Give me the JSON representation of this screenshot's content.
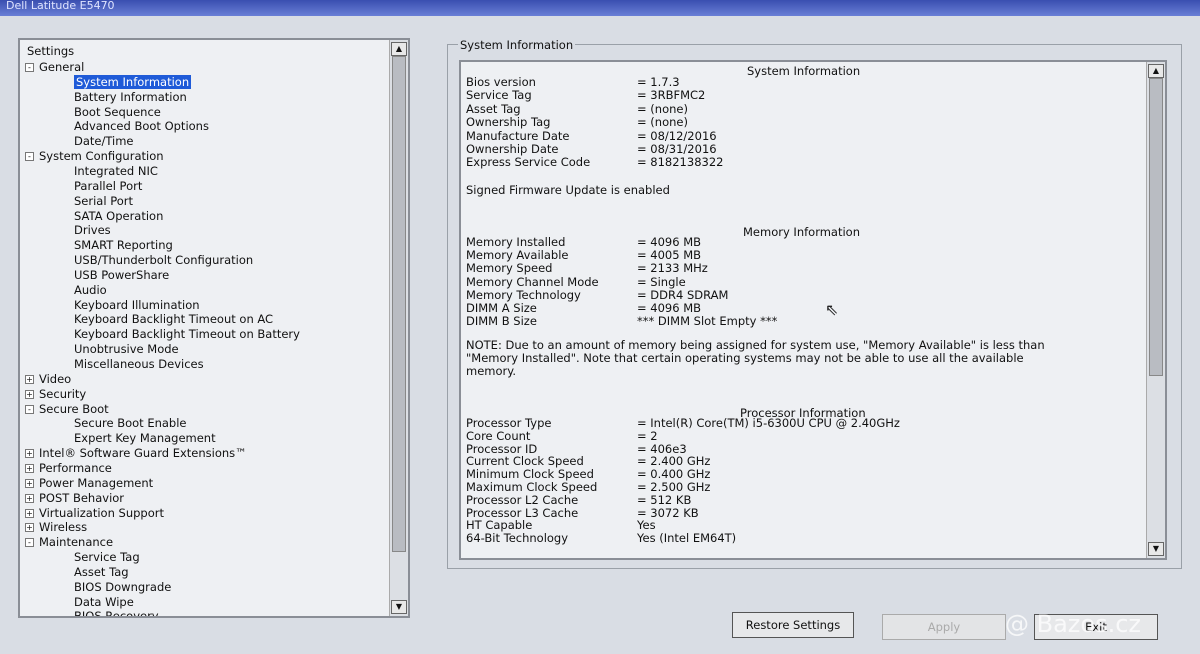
{
  "window": {
    "title": "Dell Latitude E5470"
  },
  "tree": {
    "root": "Settings",
    "items": [
      {
        "label": "General",
        "level": 0,
        "expander": "-"
      },
      {
        "label": "System Information",
        "level": 1,
        "selected": true
      },
      {
        "label": "Battery Information",
        "level": 1
      },
      {
        "label": "Boot Sequence",
        "level": 1
      },
      {
        "label": "Advanced Boot Options",
        "level": 1
      },
      {
        "label": "Date/Time",
        "level": 1
      },
      {
        "label": "System Configuration",
        "level": 0,
        "expander": "-"
      },
      {
        "label": "Integrated NIC",
        "level": 1
      },
      {
        "label": "Parallel Port",
        "level": 1
      },
      {
        "label": "Serial Port",
        "level": 1
      },
      {
        "label": "SATA Operation",
        "level": 1
      },
      {
        "label": "Drives",
        "level": 1
      },
      {
        "label": "SMART Reporting",
        "level": 1
      },
      {
        "label": "USB/Thunderbolt Configuration",
        "level": 1
      },
      {
        "label": "USB PowerShare",
        "level": 1
      },
      {
        "label": "Audio",
        "level": 1
      },
      {
        "label": "Keyboard Illumination",
        "level": 1
      },
      {
        "label": "Keyboard Backlight Timeout on AC",
        "level": 1
      },
      {
        "label": "Keyboard Backlight Timeout on Battery",
        "level": 1
      },
      {
        "label": "Unobtrusive Mode",
        "level": 1
      },
      {
        "label": "Miscellaneous Devices",
        "level": 1
      },
      {
        "label": "Video",
        "level": 0,
        "expander": "+"
      },
      {
        "label": "Security",
        "level": 0,
        "expander": "+"
      },
      {
        "label": "Secure Boot",
        "level": 0,
        "expander": "-"
      },
      {
        "label": "Secure Boot Enable",
        "level": 1
      },
      {
        "label": "Expert Key Management",
        "level": 1
      },
      {
        "label": "Intel® Software Guard Extensions™",
        "level": 0,
        "expander": "+"
      },
      {
        "label": "Performance",
        "level": 0,
        "expander": "+"
      },
      {
        "label": "Power Management",
        "level": 0,
        "expander": "+"
      },
      {
        "label": "POST Behavior",
        "level": 0,
        "expander": "+"
      },
      {
        "label": "Virtualization Support",
        "level": 0,
        "expander": "+"
      },
      {
        "label": "Wireless",
        "level": 0,
        "expander": "+"
      },
      {
        "label": "Maintenance",
        "level": 0,
        "expander": "-"
      },
      {
        "label": "Service Tag",
        "level": 1
      },
      {
        "label": "Asset Tag",
        "level": 1
      },
      {
        "label": "BIOS Downgrade",
        "level": 1
      },
      {
        "label": "Data Wipe",
        "level": 1
      },
      {
        "label": "BIOS Recovery",
        "level": 1
      }
    ]
  },
  "group_title": "System Information",
  "info": {
    "sys_heading": "System Information",
    "sys_rows": [
      {
        "k": "Bios version",
        "v": "= 1.7.3"
      },
      {
        "k": "Service Tag",
        "v": "= 3RBFMC2"
      },
      {
        "k": "Asset Tag",
        "v": "= (none)"
      },
      {
        "k": "Ownership Tag",
        "v": "= (none)"
      },
      {
        "k": "Manufacture Date",
        "v": "= 08/12/2016"
      },
      {
        "k": "Ownership Date",
        "v": "= 08/31/2016"
      },
      {
        "k": "Express Service Code",
        "v": "= 8182138322"
      }
    ],
    "firmware_note": "Signed Firmware Update is enabled",
    "mem_heading": "Memory Information",
    "mem_rows": [
      {
        "k": "Memory Installed",
        "v": "= 4096 MB"
      },
      {
        "k": "Memory Available",
        "v": "= 4005 MB"
      },
      {
        "k": "Memory Speed",
        "v": "= 2133 MHz"
      },
      {
        "k": "Memory Channel Mode",
        "v": "= Single"
      },
      {
        "k": "Memory Technology",
        "v": "= DDR4 SDRAM"
      },
      {
        "k": "DIMM A Size",
        "v": "= 4096 MB"
      },
      {
        "k": "DIMM B Size",
        "v": "*** DIMM Slot Empty ***"
      }
    ],
    "mem_note": "NOTE: Due to an amount of memory being assigned for system use, \"Memory Available\" is less than \"Memory Installed\". Note that certain operating systems may not be able to use all the available memory.",
    "proc_heading": "Processor Information",
    "proc_rows": [
      {
        "k": "Processor Type",
        "v": "= Intel(R) Core(TM) i5-6300U CPU @ 2.40GHz"
      },
      {
        "k": "Core Count",
        "v": "= 2"
      },
      {
        "k": "Processor ID",
        "v": "= 406e3"
      },
      {
        "k": "Current Clock Speed",
        "v": "= 2.400 GHz"
      },
      {
        "k": "Minimum Clock Speed",
        "v": "= 0.400 GHz"
      },
      {
        "k": "Maximum Clock Speed",
        "v": "= 2.500 GHz"
      },
      {
        "k": "Processor L2 Cache",
        "v": "= 512 KB"
      },
      {
        "k": "Processor L3 Cache",
        "v": "= 3072 KB"
      },
      {
        "k": "HT Capable",
        "v": "Yes"
      },
      {
        "k": "64-Bit Technology",
        "v": "Yes (Intel EM64T)"
      }
    ]
  },
  "buttons": {
    "restore": "Restore Settings",
    "apply": "Apply",
    "exit": "Exit"
  },
  "watermark": "@ Bazos.cz",
  "colors": {
    "selection": "#1f5bd8",
    "panel": "#eef0f3",
    "background": "#d9dde4",
    "titlebar": "#3a4fb0"
  }
}
